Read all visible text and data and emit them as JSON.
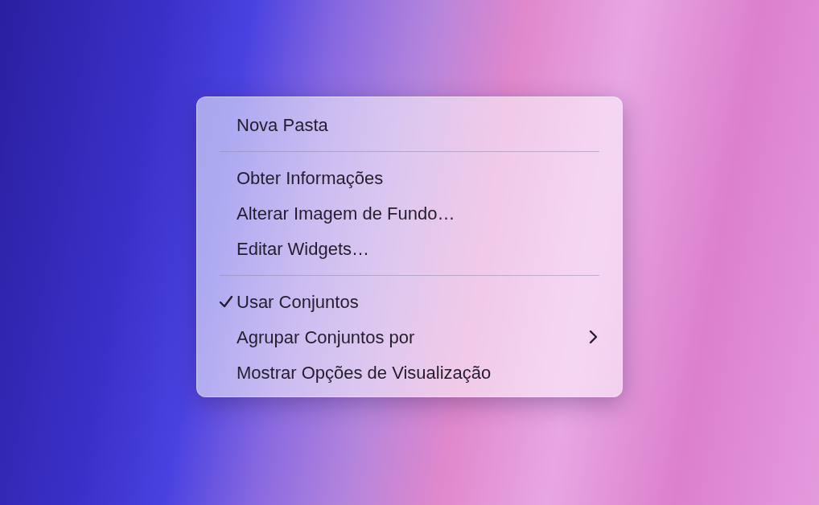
{
  "context_menu": {
    "items": [
      {
        "kind": "item",
        "label": "Nova Pasta",
        "checked": false,
        "submenu": false
      },
      {
        "kind": "separator"
      },
      {
        "kind": "item",
        "label": "Obter Informações",
        "checked": false,
        "submenu": false
      },
      {
        "kind": "item",
        "label": "Alterar Imagem de Fundo…",
        "checked": false,
        "submenu": false
      },
      {
        "kind": "item",
        "label": "Editar Widgets…",
        "checked": false,
        "submenu": false
      },
      {
        "kind": "separator"
      },
      {
        "kind": "item",
        "label": "Usar Conjuntos",
        "checked": true,
        "submenu": false
      },
      {
        "kind": "item",
        "label": "Agrupar Conjuntos por",
        "checked": false,
        "submenu": true
      },
      {
        "kind": "item",
        "label": "Mostrar Opções de Visualização",
        "checked": false,
        "submenu": false
      }
    ]
  }
}
